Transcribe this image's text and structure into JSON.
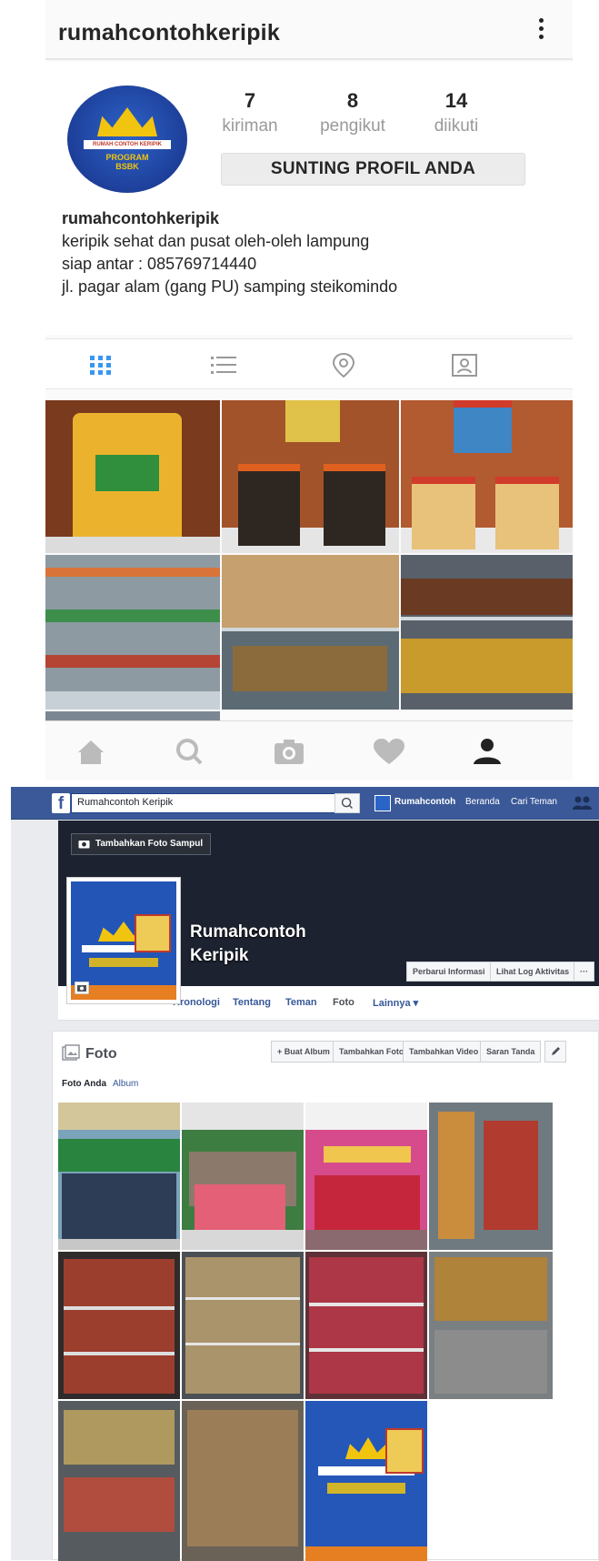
{
  "instagram": {
    "username": "rumahcontohkeripik",
    "stats": [
      {
        "num": "7",
        "label": "kiriman"
      },
      {
        "num": "8",
        "label": "pengikut"
      },
      {
        "num": "14",
        "label": "diikuti"
      }
    ],
    "edit_button": "SUNTING PROFIL ANDA",
    "avatar_text": "RUMAH CONTOH KERIPIK",
    "avatar_text2": "PROGRAM BSBK",
    "bio": {
      "name": "rumahcontohkeripik",
      "line1": "keripik sehat dan pusat oleh-oleh lampung",
      "line2": "siap antar : 085769714440",
      "line3": "jl. pagar alam (gang PU) samping steikomindo"
    },
    "tabs": [
      "grid-icon",
      "list-icon",
      "location-icon",
      "tagged-icon"
    ],
    "bottom_nav": [
      "home-icon",
      "search-icon",
      "camera-icon",
      "heart-icon",
      "profile-icon"
    ]
  },
  "facebook": {
    "search_value": "Rumahcontoh Keripik",
    "nav_user": "Rumahcontoh",
    "nav_home": "Beranda",
    "nav_find_friends": "Cari Teman",
    "cover_button": "Tambahkan Foto Sampul",
    "name_line1": "Rumahcontoh",
    "name_line2": "Keripik",
    "update_info": "Perbarui Informasi",
    "activity_log": "Lihat Log Aktivitas",
    "more": "···",
    "tabs": [
      "Kronologi",
      "Tentang",
      "Teman",
      "Foto",
      "Lainnya ▾"
    ],
    "photos_title": "Foto",
    "btn_create_album": "+ Buat Album",
    "btn_add_photo": "Tambahkan Foto",
    "btn_add_video": "Tambahkan Video",
    "btn_tag_suggest": "Saran Tanda",
    "sub_your_photos": "Foto Anda",
    "sub_album": "Album"
  },
  "colors": {
    "fb_blue": "#3b5998",
    "ig_muted": "#999999",
    "fb_link": "#365899"
  }
}
